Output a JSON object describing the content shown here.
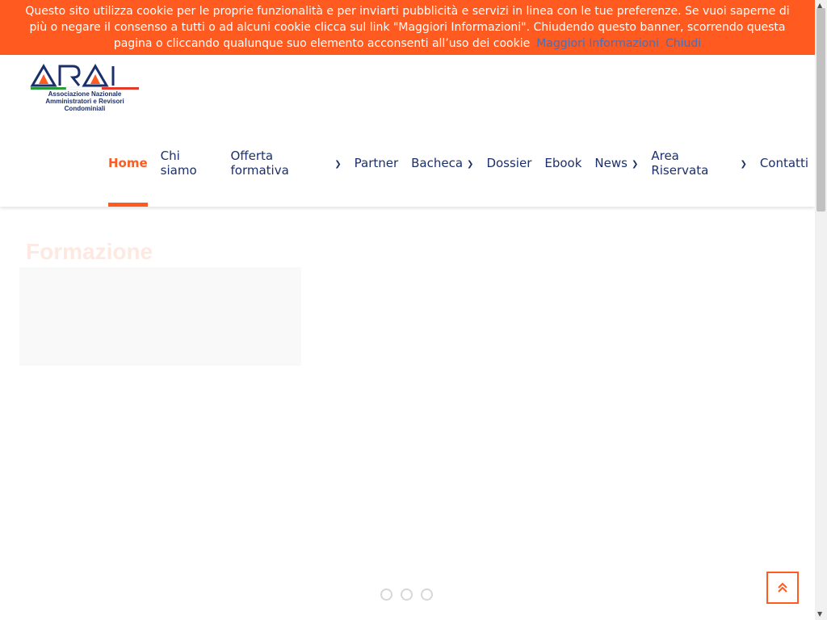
{
  "cookie_banner": {
    "text": "Questo sito utilizza cookie per le proprie funzionalità e per inviarti pubblicità e servizi in linea con le tue preferenze. Se vuoi saperne di più o negare il consenso a tutti o ad alcuni cookie clicca sul link \"Maggiori Informazioni\". Chiudendo questo banner, scorrendo questa pagina o cliccando qualunque suo elemento acconsenti all’uso dei cookie",
    "more_info_label": "Maggiori Informazioni",
    "close_label": "Chiudi"
  },
  "logo": {
    "name": "ARAI",
    "subtitle_line1": "Associazione Nazionale",
    "subtitle_line2": "Amministratori e Revisori Condominiali"
  },
  "nav": {
    "items": [
      {
        "label": "Home",
        "active": true,
        "dropdown": false
      },
      {
        "label": "Chi siamo",
        "dropdown": false
      },
      {
        "label": "Offerta formativa",
        "dropdown": true
      },
      {
        "label": "Partner",
        "dropdown": false
      },
      {
        "label": "Bacheca",
        "dropdown": true
      },
      {
        "label": "Dossier",
        "dropdown": false
      },
      {
        "label": "Ebook",
        "dropdown": false
      },
      {
        "label": "News",
        "dropdown": true
      },
      {
        "label": "Area Riservata",
        "dropdown": true
      },
      {
        "label": "Contatti",
        "dropdown": false
      }
    ]
  },
  "hero": {
    "title": "Formazione"
  },
  "slider": {
    "dot_count": 3
  },
  "colors": {
    "accent": "#ff5a1f",
    "nav_text": "#1b2f6b",
    "link": "#4a6fb5"
  },
  "icons": {
    "back_to_top": "double-chevron-up-icon",
    "dropdown": "chevron-down-icon"
  }
}
